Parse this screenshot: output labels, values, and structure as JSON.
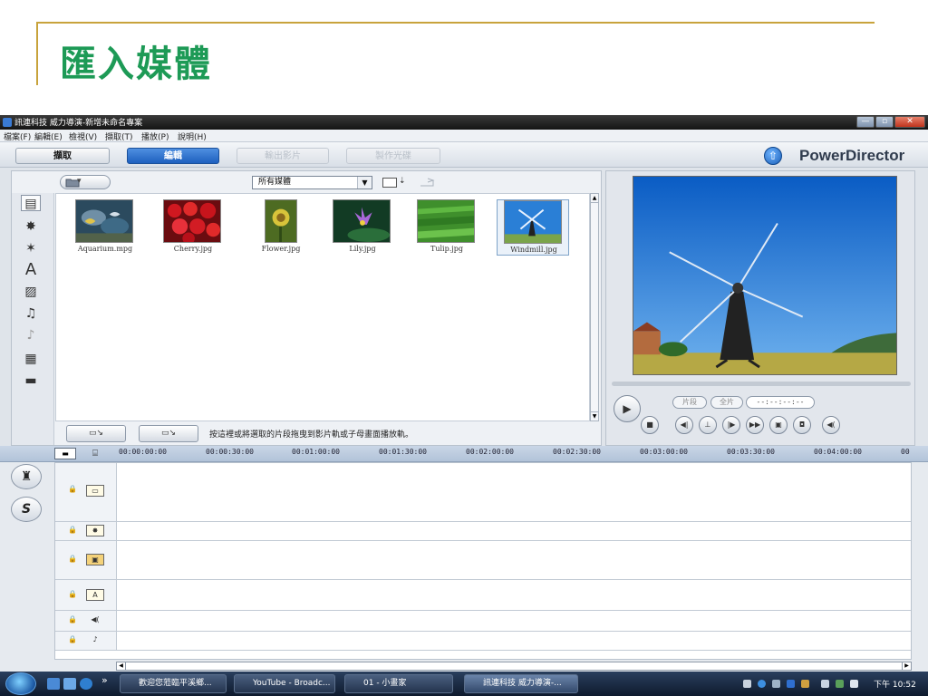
{
  "slide": {
    "title": "匯入媒體"
  },
  "window": {
    "title": "訊連科技 威力導演-新增未命名專案",
    "controls": {
      "minimize": "—",
      "maximize": "▫",
      "close": "✕"
    }
  },
  "menu": {
    "items": [
      "檔案(F)",
      "編輯(E)",
      "檢視(V)",
      "擷取(T)",
      "播放(P)",
      "說明(H)"
    ]
  },
  "modes": {
    "capture": "擷取",
    "edit": "編輯",
    "produce": "輸出影片",
    "disc": "製作光碟"
  },
  "brand": {
    "name": "PowerDirector",
    "logo_glyph": "⇧"
  },
  "library": {
    "folder_glyph": "▾",
    "filter_value": "所有媒體",
    "filter_arrow": "▼",
    "sort_glyph": "⇣",
    "media": [
      {
        "name": "Aquarium.mpg"
      },
      {
        "name": "Cherry.jpg"
      },
      {
        "name": "Flower.jpg"
      },
      {
        "name": "Lily.jpg"
      },
      {
        "name": "Tulip.jpg"
      },
      {
        "name": "Windmill.jpg"
      }
    ],
    "scroll_up": "▲",
    "scroll_down": "▼",
    "add_track_label": "▭↘",
    "add_sub_label": "▭↘",
    "hint": "按這裡或將選取的片段拖曳到影片軌或子母畫面播放軌。"
  },
  "side_tools": {
    "media": "▤",
    "effects": "✸",
    "pip": "✶",
    "title": "A",
    "transition": "▨",
    "audio_mix": "♫",
    "voice": "♪",
    "chapters": "▦",
    "subtitles": "▬"
  },
  "preview": {
    "play_glyph": "▶",
    "clip_label": "片段",
    "movie_label": "全片",
    "timecode": "--:--:--:--",
    "buttons": [
      "■",
      "◀|",
      "⊥",
      "|▶",
      "▶▶",
      "▣",
      "◘",
      "◀("
    ]
  },
  "timeline": {
    "view1_glyph": "▬",
    "view2_glyph": "⌸",
    "ticks": [
      "00:00:00:00",
      "00:00:30:00",
      "00:01:00:00",
      "00:01:30:00",
      "00:02:00:00",
      "00:02:30:00",
      "00:03:00:00",
      "00:03:30:00",
      "00:04:00:00",
      "00"
    ],
    "mode_btn1": "♜",
    "mode_btn2": "S",
    "lock_glyph": "🔒",
    "tracks": [
      {
        "icon": "▭"
      },
      {
        "icon": "✸"
      },
      {
        "icon": "▣"
      },
      {
        "icon": "A"
      },
      {
        "icon": "◀("
      },
      {
        "icon": "♪"
      }
    ],
    "scroll_left": "◀",
    "scroll_right": "▶"
  },
  "taskbar": {
    "chevron": "»",
    "tasks": [
      "歡迎您蒞臨平溪鄉...",
      "YouTube - Broadc...",
      "01 - 小畫家",
      "訊連科技 威力導演-..."
    ],
    "clock": "下午 10:52"
  },
  "colors": {
    "title_green": "#1d9a56",
    "gold_rule": "#c8a33c",
    "edit_tab_blue": "#1d5fbf"
  }
}
